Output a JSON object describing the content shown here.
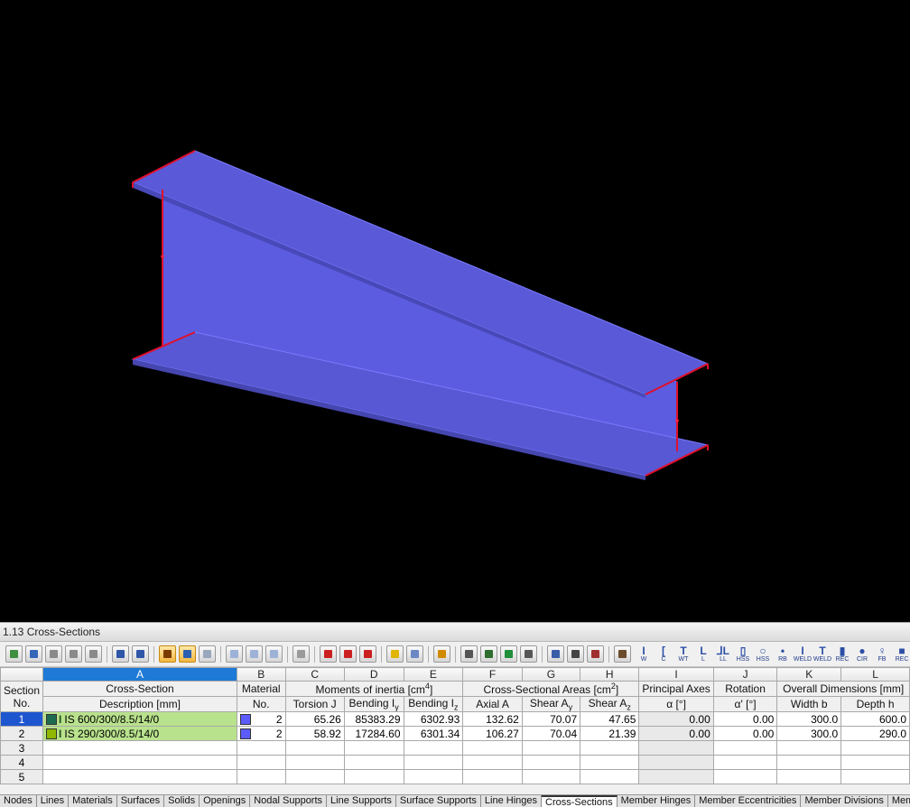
{
  "panel": {
    "title": "1.13 Cross-Sections"
  },
  "toolbar": {
    "shapes": [
      {
        "glyph": "I",
        "label": "W"
      },
      {
        "glyph": "[",
        "label": "C"
      },
      {
        "glyph": "T",
        "label": "WT"
      },
      {
        "glyph": "L",
        "label": "L"
      },
      {
        "glyph": "⅃L",
        "label": "LL"
      },
      {
        "glyph": "▯",
        "label": "HSS"
      },
      {
        "glyph": "○",
        "label": "HSS"
      },
      {
        "glyph": "•",
        "label": "RB"
      },
      {
        "glyph": "I",
        "label": "WELD"
      },
      {
        "glyph": "T",
        "label": "WELD"
      },
      {
        "glyph": "▮",
        "label": "REC"
      },
      {
        "glyph": "●",
        "label": "CIR"
      },
      {
        "glyph": "♀",
        "label": "FB"
      },
      {
        "glyph": "■",
        "label": "REC"
      }
    ]
  },
  "table": {
    "letters": [
      "A",
      "B",
      "C",
      "D",
      "E",
      "F",
      "G",
      "H",
      "I",
      "J",
      "K",
      "L"
    ],
    "section_header": "Section",
    "section_no": "No.",
    "groups": {
      "cross_section": "Cross-Section",
      "material": "Material",
      "moments": "Moments of inertia [cm",
      "moments_exp": "4",
      "areas": "Cross-Sectional Areas [cm",
      "areas_exp": "2",
      "principal": "Principal Axes",
      "rotation": "Rotation",
      "overall": "Overall Dimensions [mm]"
    },
    "subheaders": {
      "description": "Description [mm]",
      "material_no": "No.",
      "torsion": "Torsion J",
      "bending_y": "Bending I",
      "bending_y_sub": "y",
      "bending_z": "Bending I",
      "bending_z_sub": "z",
      "axial": "Axial A",
      "shear_y": "Shear A",
      "shear_y_sub": "y",
      "shear_z": "Shear A",
      "shear_z_sub": "z",
      "alpha": "α [°]",
      "alpha_prime": "α' [°]",
      "width": "Width b",
      "depth": "Depth h"
    },
    "rows": [
      {
        "no": "1",
        "swatch": "#1f6b4f",
        "desc": "IS 600/300/8.5/14/0",
        "mat": "2",
        "torsion": "65.26",
        "iy": "85383.29",
        "iz": "6302.93",
        "axial": "132.62",
        "ay": "70.07",
        "az": "47.65",
        "alpha": "0.00",
        "rot": "0.00",
        "width": "300.0",
        "depth": "600.0"
      },
      {
        "no": "2",
        "swatch": "#8fb800",
        "desc": "IS 290/300/8.5/14/0",
        "mat": "2",
        "torsion": "58.92",
        "iy": "17284.60",
        "iz": "6301.34",
        "axial": "106.27",
        "ay": "70.04",
        "az": "21.39",
        "alpha": "0.00",
        "rot": "0.00",
        "width": "300.0",
        "depth": "290.0"
      }
    ],
    "empty_rows": [
      "3",
      "4",
      "5"
    ]
  },
  "tabs": [
    "Nodes",
    "Lines",
    "Materials",
    "Surfaces",
    "Solids",
    "Openings",
    "Nodal Supports",
    "Line Supports",
    "Surface Supports",
    "Line Hinges",
    "Cross-Sections",
    "Member Hinges",
    "Member Eccentricities",
    "Member Divisions",
    "Members"
  ],
  "active_tab": "Cross-Sections",
  "colors": {
    "beam_web": "#5f5fe6",
    "beam_edge": "#d0102a",
    "selection": "#1e7ad6"
  }
}
